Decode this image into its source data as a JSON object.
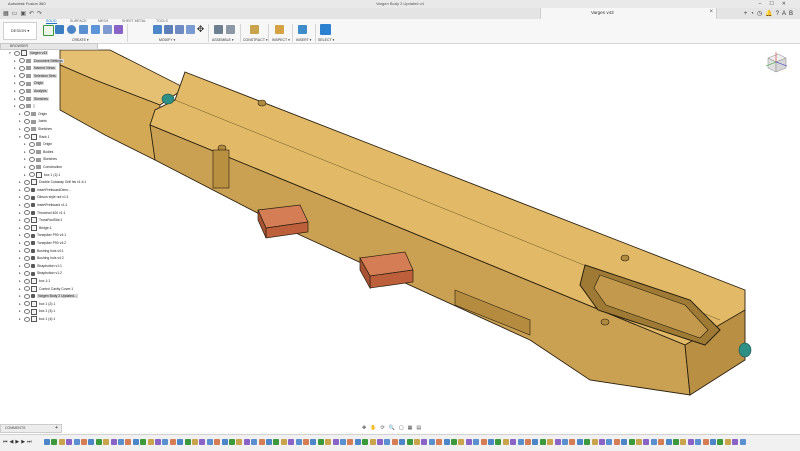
{
  "window": {
    "app_title": "Autodesk Fusion 360",
    "center_title": "Vargen Body 2 Updated v4",
    "controls": [
      "–",
      "☐",
      "✕"
    ]
  },
  "quick_access": [
    "grid",
    "folder",
    "save",
    "undo",
    "redo"
  ],
  "doc_tab": {
    "label": "Vargen v43",
    "close": "×"
  },
  "right_buttons": [
    "+",
    "◔",
    "◷",
    "🔔",
    "?",
    "AB"
  ],
  "ribbon": {
    "workspace": "DESIGN ▾",
    "tabs": [
      "SOLID",
      "SURFACE",
      "MESH",
      "SHEET METAL",
      "TOOLS"
    ],
    "active_tab": "SOLID",
    "groups": [
      "CREATE ▾",
      "MODIFY ▾",
      "ASSEMBLE ▾",
      "CONSTRUCT ▾",
      "INSPECT ▾",
      "INSERT ▾",
      "SELECT ▾"
    ]
  },
  "browser": {
    "title": "BROWSER",
    "items": [
      {
        "label": "Vargen v43",
        "depth": 0,
        "arrow": "▾",
        "type": "component",
        "highlight": true
      },
      {
        "label": "Document Settings",
        "depth": 1,
        "arrow": "▸",
        "type": "folder",
        "highlight": true
      },
      {
        "label": "Named Views",
        "depth": 1,
        "arrow": "▸",
        "type": "folder",
        "highlight": true
      },
      {
        "label": "Selection Sets",
        "depth": 1,
        "arrow": "▸",
        "type": "folder",
        "highlight": true
      },
      {
        "label": "Origin",
        "depth": 1,
        "arrow": "▸",
        "type": "folder",
        "highlight": true
      },
      {
        "label": "Analysis",
        "depth": 1,
        "arrow": "▸",
        "type": "folder",
        "highlight": true
      },
      {
        "label": "Sketches",
        "depth": 1,
        "arrow": "▸",
        "type": "folder",
        "highlight": true
      },
      {
        "label": "",
        "depth": 1,
        "arrow": "▸",
        "type": "folder",
        "highlight": true
      },
      {
        "label": "Origin",
        "depth": 2,
        "arrow": "▸",
        "type": "folder",
        "highlight": false
      },
      {
        "label": "Joints",
        "depth": 2,
        "arrow": "▸",
        "type": "folder",
        "highlight": false
      },
      {
        "label": "Sketches",
        "depth": 2,
        "arrow": "▸",
        "type": "folder",
        "highlight": false
      },
      {
        "label": "Rack 1",
        "depth": 2,
        "arrow": "▾",
        "type": "component",
        "highlight": false
      },
      {
        "label": "Origin",
        "depth": 3,
        "arrow": "▸",
        "type": "folder",
        "highlight": false
      },
      {
        "label": "Bodies",
        "depth": 3,
        "arrow": "▸",
        "type": "folder",
        "highlight": false
      },
      {
        "label": "Sketches",
        "depth": 3,
        "arrow": "▸",
        "type": "folder",
        "highlight": false
      },
      {
        "label": "Construction",
        "depth": 3,
        "arrow": "▸",
        "type": "folder",
        "highlight": false
      },
      {
        "label": "box 1 (1):1",
        "depth": 3,
        "arrow": "▸",
        "type": "component",
        "highlight": false
      },
      {
        "label": "Double Cutaway Grill hls v1:4:1",
        "depth": 2,
        "arrow": "▸",
        "type": "component",
        "highlight": false
      },
      {
        "label": "InsertFretboardDimn...",
        "depth": 2,
        "arrow": "▸",
        "type": "link",
        "highlight": false
      },
      {
        "label": "Gibson style nut v1:1",
        "depth": 2,
        "arrow": "▸",
        "type": "link",
        "highlight": false
      },
      {
        "label": "InsertFretboard v1:1",
        "depth": 2,
        "arrow": "▸",
        "type": "link",
        "highlight": false
      },
      {
        "label": "Thrustrod 400 v1:1",
        "depth": 2,
        "arrow": "▸",
        "type": "link",
        "highlight": false
      },
      {
        "label": "TrussRodSlot:1",
        "depth": 2,
        "arrow": "▸",
        "type": "component",
        "highlight": false
      },
      {
        "label": "Bridge:1",
        "depth": 2,
        "arrow": "▸",
        "type": "component",
        "highlight": false
      },
      {
        "label": "Tonepiker P90 v4:1",
        "depth": 2,
        "arrow": "▸",
        "type": "link",
        "highlight": false
      },
      {
        "label": "Tonepiker P90 v4:2",
        "depth": 2,
        "arrow": "▸",
        "type": "link",
        "highlight": false
      },
      {
        "label": "Bushing hols v4:1",
        "depth": 2,
        "arrow": "▸",
        "type": "link",
        "highlight": false
      },
      {
        "label": "Bushing hols v4:2",
        "depth": 2,
        "arrow": "▸",
        "type": "link",
        "highlight": false
      },
      {
        "label": "Strapbutton v1:1",
        "depth": 2,
        "arrow": "▸",
        "type": "link",
        "highlight": false
      },
      {
        "label": "Strapbutton v1:2",
        "depth": 2,
        "arrow": "▸",
        "type": "link",
        "highlight": false
      },
      {
        "label": "box 1:1",
        "depth": 2,
        "arrow": "▸",
        "type": "component",
        "highlight": false
      },
      {
        "label": "Control Cavity Cover:1",
        "depth": 2,
        "arrow": "▸",
        "type": "component",
        "highlight": false
      },
      {
        "label": "Vargen Body 2 Updated...",
        "depth": 2,
        "arrow": "▸",
        "type": "link",
        "highlight": true
      },
      {
        "label": "box 1 (2):1",
        "depth": 2,
        "arrow": "▸",
        "type": "component",
        "highlight": false
      },
      {
        "label": "box 1 (3):1",
        "depth": 2,
        "arrow": "▸",
        "type": "component",
        "highlight": false
      },
      {
        "label": "box 1 (4):1",
        "depth": 2,
        "arrow": "▸",
        "type": "component",
        "highlight": false
      }
    ]
  },
  "comments": {
    "title": "COMMENTS",
    "add": "+"
  },
  "nav_bar": [
    "✥",
    "✋",
    "⟳",
    "🔍",
    "▢",
    "▦",
    "▤"
  ],
  "timeline": {
    "controls": [
      "⏮",
      "◀",
      "▶",
      "▶",
      "⏭"
    ]
  },
  "colors": {
    "body_fill": "#e2b966",
    "body_edge": "#2a2110",
    "insert_copper": "#c96a44",
    "knob_teal": "#2e8f86",
    "ribbon_accent": "#1a73c8"
  }
}
